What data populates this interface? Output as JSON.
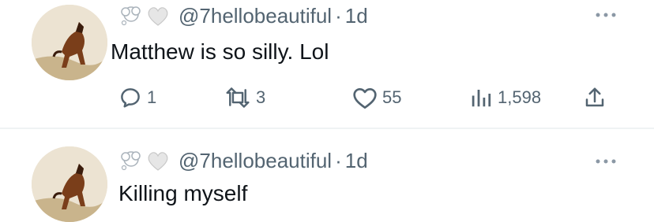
{
  "tweets": [
    {
      "handle": "@7hellobeautiful",
      "separator": "·",
      "time": "1d",
      "text": "Matthew is so silly. Lol",
      "replies": "1",
      "retweets": "3",
      "likes": "55",
      "views": "1,598"
    },
    {
      "handle": "@7hellobeautiful",
      "separator": "·",
      "time": "1d",
      "text": "Killing myself"
    }
  ],
  "icons": {
    "avatar": "horse-avatar",
    "header_emoji": [
      "thought-bubble-icon",
      "white-heart-icon"
    ],
    "more": "more-options-icon",
    "actions": [
      "reply-icon",
      "retweet-icon",
      "like-icon",
      "views-icon",
      "share-icon"
    ]
  },
  "colors": {
    "muted_text": "#536471",
    "main_text": "#0f1419",
    "divider": "#eff3f4"
  }
}
